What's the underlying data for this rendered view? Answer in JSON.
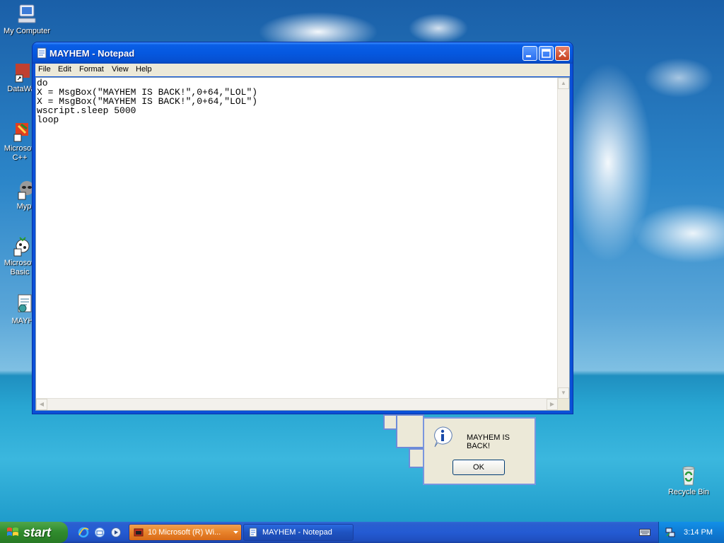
{
  "desktop": {
    "icons": [
      {
        "label": "My Computer"
      },
      {
        "label": "DataWa"
      },
      {
        "label": "Microsoft"
      },
      {
        "label": "C++"
      },
      {
        "label": "Myp"
      },
      {
        "label": "Microsoft"
      },
      {
        "label": "Basic"
      },
      {
        "label": "MAYH"
      },
      {
        "label": "Recycle Bin"
      }
    ]
  },
  "notepad": {
    "title": "MAYHEM - Notepad",
    "menu": [
      "File",
      "Edit",
      "Format",
      "View",
      "Help"
    ],
    "content": "do\nX = MsgBox(\"MAYHEM IS BACK!\",0+64,\"LOL\")\nX = MsgBox(\"MAYHEM IS BACK!\",0+64,\"LOL\")\nwscript.sleep 5000\nloop"
  },
  "msgbox": {
    "message": "MAYHEM IS BACK!",
    "ok_label": "OK"
  },
  "taskbar": {
    "start_label": "start",
    "tasks": [
      {
        "label": "10 Microsoft (R) Wi...",
        "active": true
      },
      {
        "label": "MAYHEM - Notepad",
        "active": false
      }
    ],
    "clock": "3:14 PM"
  },
  "colors": {
    "title_blue": "#0558e0",
    "start_green": "#2f8a2c",
    "active_task_orange": "#e8822a",
    "close_red": "#c5401e"
  }
}
